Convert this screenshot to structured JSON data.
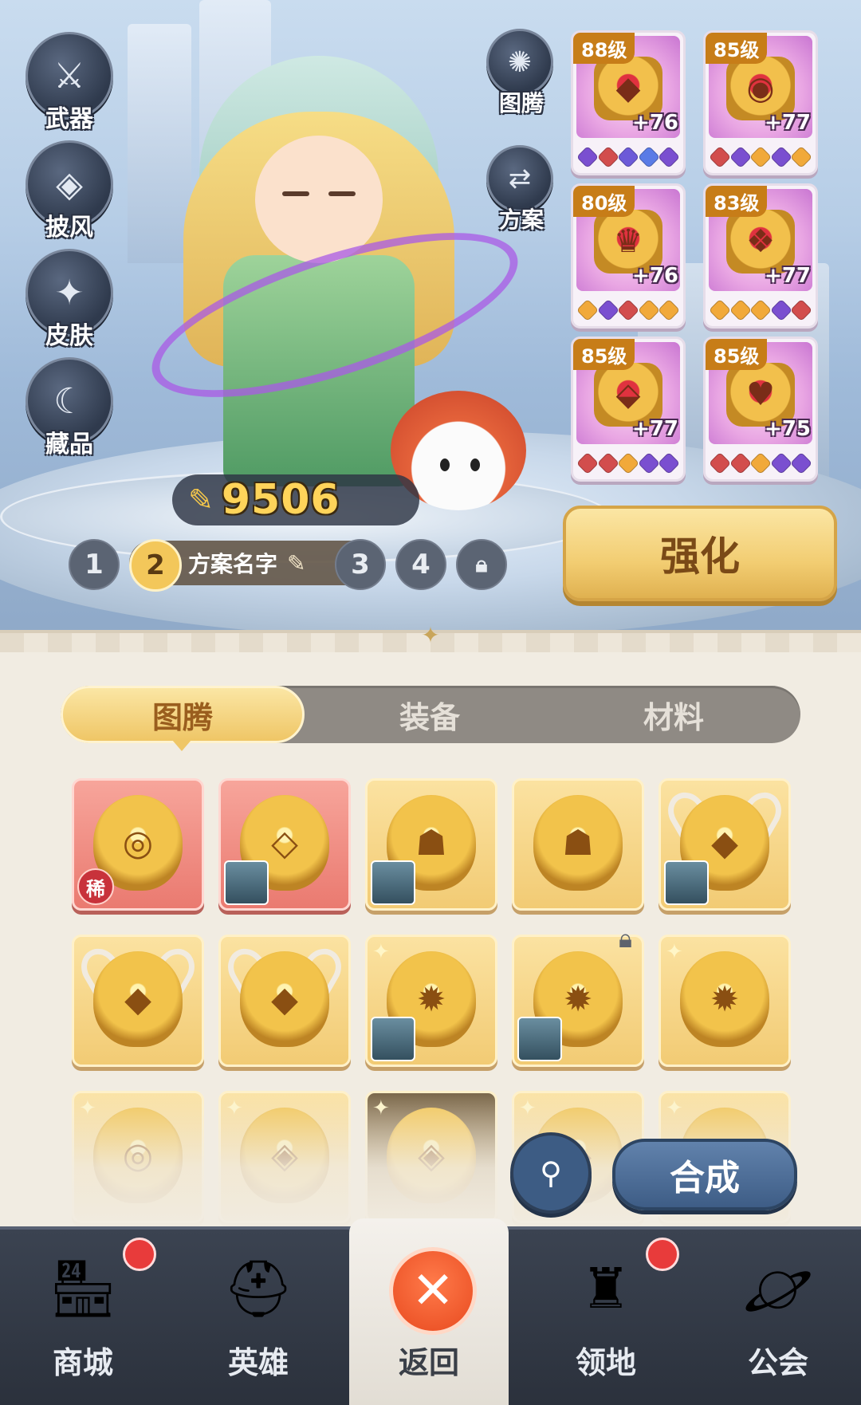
{
  "sidebar": {
    "weapon": "武器",
    "cape": "披风",
    "skin": "皮肤",
    "collection": "藏品"
  },
  "right_buttons": {
    "totem": "图腾",
    "plan": "方案"
  },
  "power": {
    "value": "9506"
  },
  "plans": {
    "items": [
      "1",
      "2",
      "3",
      "4"
    ],
    "active": "2",
    "active_name": "方案名字"
  },
  "strengthen_label": "强化",
  "equipment": [
    {
      "level": "88级",
      "plus": "+76",
      "gems": [
        "#7a4fd0",
        "#d24d4d",
        "#6c5ad8",
        "#5a7be6",
        "#7a4fd0"
      ]
    },
    {
      "level": "85级",
      "plus": "+77",
      "gems": [
        "#d24d4d",
        "#7a4fd0",
        "#f1a93a",
        "#7a4fd0",
        "#f1a93a"
      ]
    },
    {
      "level": "80级",
      "plus": "+76",
      "gems": [
        "#f1a93a",
        "#7a4fd0",
        "#d24d4d",
        "#f1a93a",
        "#f1a93a"
      ]
    },
    {
      "level": "83级",
      "plus": "+77",
      "gems": [
        "#f1a93a",
        "#f1a93a",
        "#f1a93a",
        "#7a4fd0",
        "#d24d4d"
      ]
    },
    {
      "level": "85级",
      "plus": "+77",
      "gems": [
        "#d24d4d",
        "#d24d4d",
        "#f1a93a",
        "#7a4fd0",
        "#7a4fd0"
      ]
    },
    {
      "level": "85级",
      "plus": "+75",
      "gems": [
        "#d24d4d",
        "#d24d4d",
        "#f1a93a",
        "#7a4fd0",
        "#7a4fd0"
      ]
    }
  ],
  "tabs": {
    "totem": "图腾",
    "equipment": "装备",
    "materials": "材料",
    "active": "图腾"
  },
  "inventory": [
    {
      "kind": "owl",
      "rarity": "red",
      "tag": "稀"
    },
    {
      "kind": "fox",
      "rarity": "red",
      "owner": true
    },
    {
      "kind": "bear",
      "rarity": "gold",
      "owner": true
    },
    {
      "kind": "bear",
      "rarity": "gold"
    },
    {
      "kind": "bull",
      "rarity": "gold",
      "owner": true
    },
    {
      "kind": "bull",
      "rarity": "gold"
    },
    {
      "kind": "bull",
      "rarity": "gold"
    },
    {
      "kind": "phoenix",
      "rarity": "gold",
      "star": true,
      "owner": true
    },
    {
      "kind": "phoenix",
      "rarity": "gold",
      "star": true,
      "owner": true,
      "locked": true
    },
    {
      "kind": "phoenix",
      "rarity": "gold",
      "star": true
    }
  ],
  "filter_icon": "filter-icon",
  "synthesize_label": "合成",
  "nav": {
    "shop": "商城",
    "heroes": "英雄",
    "back": "返回",
    "territory": "领地",
    "guild": "公会"
  },
  "colors": {
    "gold_button": "#f2cd72",
    "nav_bg": "#2b313c",
    "badge_red": "#e83b3b",
    "slot_gold": "#f2cb74",
    "slot_red": "#ea7a70"
  }
}
